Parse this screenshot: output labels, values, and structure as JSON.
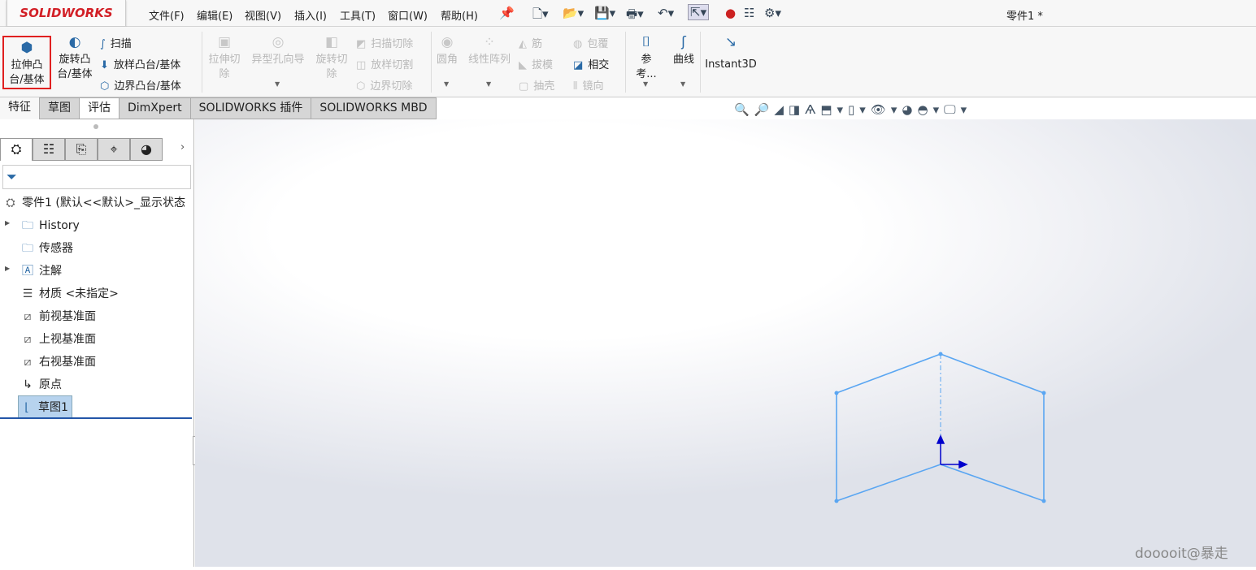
{
  "app": {
    "logo": "SOLIDWORKS",
    "document_title": "零件1 *"
  },
  "menu": [
    "文件(F)",
    "编辑(E)",
    "视图(V)",
    "插入(I)",
    "工具(T)",
    "窗口(W)",
    "帮助(H)"
  ],
  "quick_access_icons": [
    "new-icon",
    "open-icon",
    "save-icon",
    "print-icon",
    "undo-icon",
    "select-icon",
    "rebuild-icon",
    "file-properties-icon",
    "options-icon"
  ],
  "ribbon": {
    "extrude_boss": "拉伸凸台/基体",
    "revolve_boss": "旋转凸台/基体",
    "sweep": "扫描",
    "loft": "放样凸台/基体",
    "boundary": "边界凸台/基体",
    "extrude_cut": "拉伸切除",
    "hole_wizard": "异型孔向导",
    "revolve_cut": "旋转切除",
    "swept_cut": "扫描切除",
    "lofted_cut": "放样切割",
    "boundary_cut": "边界切除",
    "fillet": "圆角",
    "linear_pattern": "线性阵列",
    "rib": "筋",
    "wrap": "包覆",
    "draft": "拔模",
    "intersect": "相交",
    "shell": "抽壳",
    "mirror": "镜向",
    "reference": "参考...",
    "curves": "曲线",
    "instant3d": "Instant3D"
  },
  "tabs": [
    "特征",
    "草图",
    "评估",
    "DimXpert",
    "SOLIDWORKS 插件",
    "SOLIDWORKS MBD"
  ],
  "active_tab": "评估",
  "tree": {
    "root": "零件1  (默认<<默认>_显示状态",
    "items": [
      "History",
      "传感器",
      "注解",
      "材质 <未指定>",
      "前视基准面",
      "上视基准面",
      "右视基准面",
      "原点",
      "草图1"
    ],
    "selected": "草图1"
  },
  "sketch_color": "#5aa6f2",
  "watermark": "dooooit@暴走"
}
